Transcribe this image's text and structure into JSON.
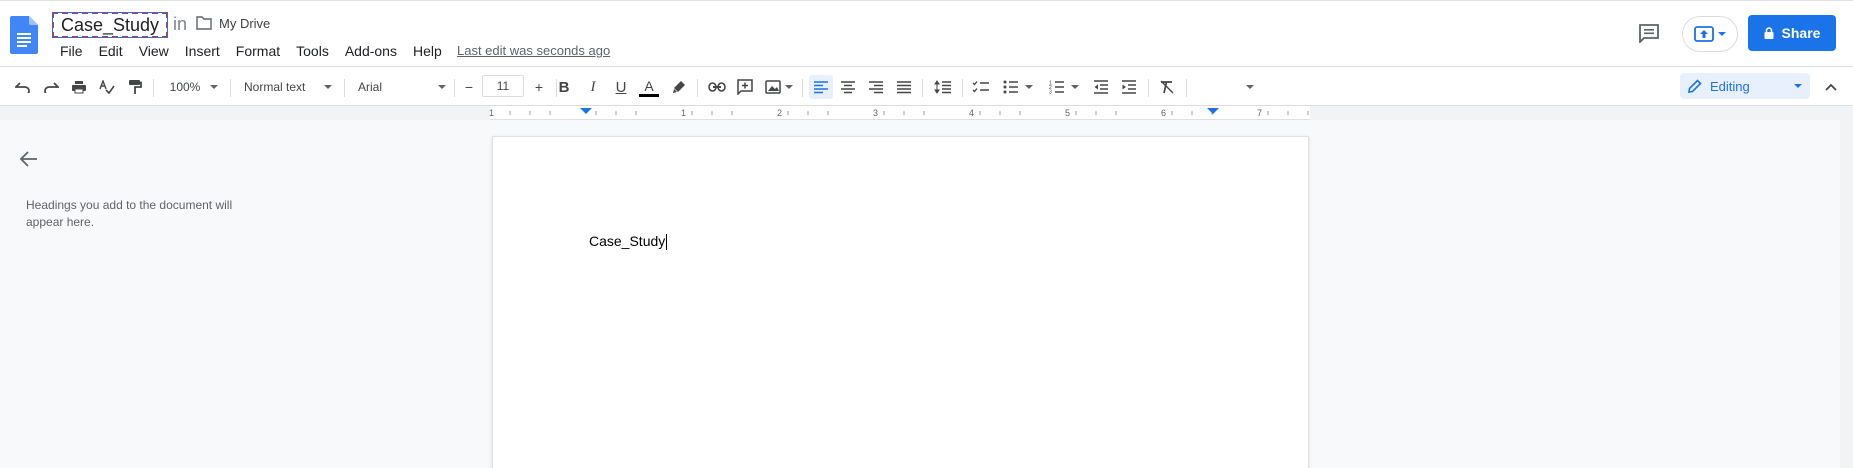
{
  "header": {
    "title": "Case_Study",
    "in_label": "in",
    "location": "My Drive",
    "last_edit": "Last edit was seconds ago",
    "share_label": "Share"
  },
  "menu": [
    "File",
    "Edit",
    "View",
    "Insert",
    "Format",
    "Tools",
    "Add-ons",
    "Help"
  ],
  "toolbar": {
    "zoom": "100%",
    "style": "Normal text",
    "font": "Arial",
    "font_size": "11",
    "minus": "−",
    "plus": "+",
    "bold": "B",
    "italic": "I",
    "underline": "U",
    "text_color_letter": "A",
    "mode": "Editing"
  },
  "ruler": {
    "labels": [
      "1",
      "1",
      "2",
      "3",
      "4",
      "5",
      "6",
      "7"
    ]
  },
  "outline": {
    "hint": "Headings you add to the document will appear here."
  },
  "document": {
    "body_text": "Case_Study"
  },
  "colors": {
    "accent": "#1a73e8",
    "title_outline": "#d93025",
    "background": "#f8f9fa"
  }
}
